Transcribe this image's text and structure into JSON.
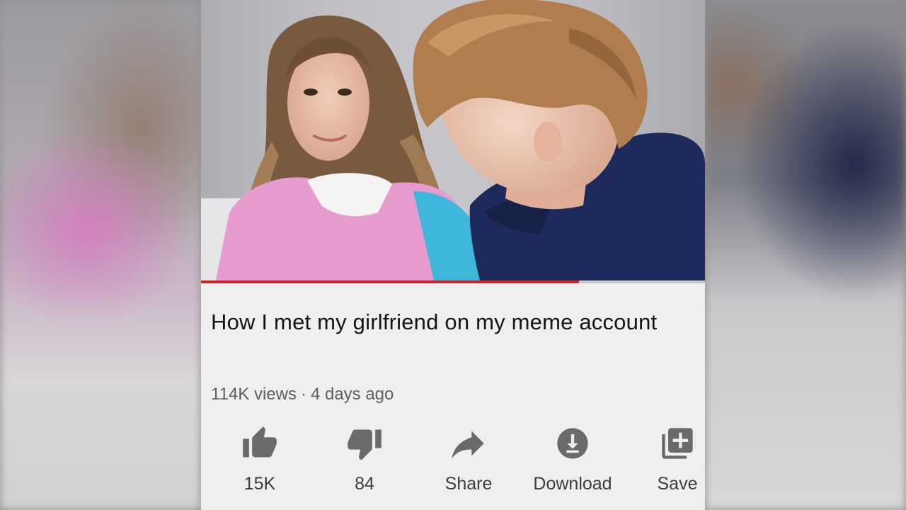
{
  "video": {
    "title": "How I met my girlfriend on my meme account",
    "views": "114K views",
    "separator": "·",
    "age": "4 days ago",
    "progress_fraction": 0.75
  },
  "actions": {
    "like": {
      "label": "15K",
      "icon": "thumbs-up-icon"
    },
    "dislike": {
      "label": "84",
      "icon": "thumbs-down-icon"
    },
    "share": {
      "label": "Share",
      "icon": "share-arrow-icon"
    },
    "download": {
      "label": "Download",
      "icon": "download-icon"
    },
    "save": {
      "label": "Save",
      "icon": "playlist-add-icon"
    }
  },
  "colors": {
    "progress": "#d32222",
    "icon": "#6a6a6a",
    "background": "#efeff0"
  }
}
